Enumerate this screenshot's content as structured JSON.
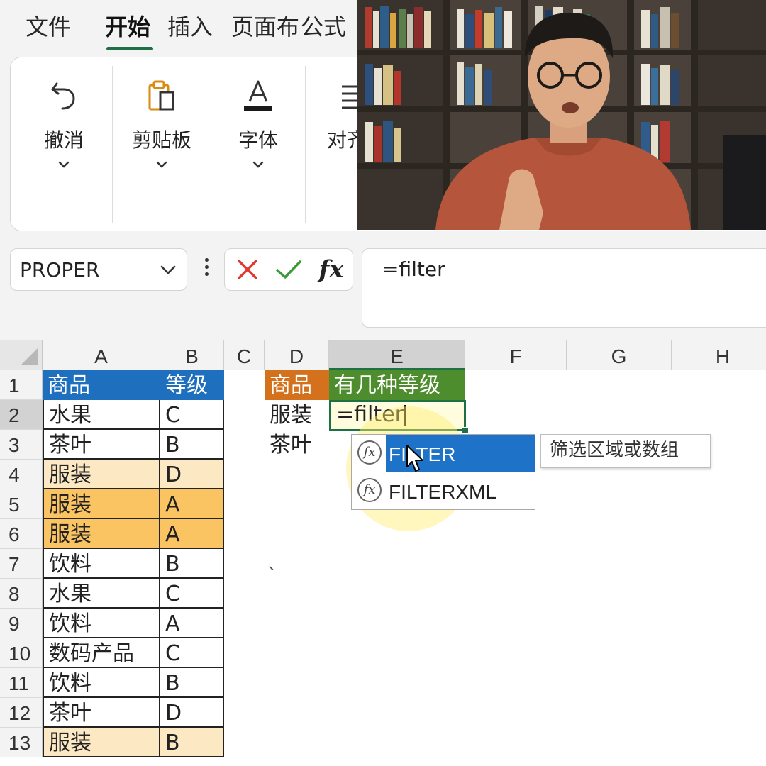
{
  "menu_tabs": [
    {
      "label": "文件"
    },
    {
      "label": "开始",
      "active": true
    },
    {
      "label": "插入"
    },
    {
      "label": "页面布"
    },
    {
      "label": "公式"
    }
  ],
  "ribbon": {
    "groups": [
      {
        "label": "撤消",
        "icon": "undo-icon"
      },
      {
        "label": "剪贴板",
        "icon": "clipboard-icon"
      },
      {
        "label": "字体",
        "icon": "font-color-icon"
      },
      {
        "label": "对齐",
        "icon": "align-icon"
      }
    ]
  },
  "formula_row": {
    "name_box": "PROPER",
    "formula": "=filter",
    "fx_label": "fx"
  },
  "grid": {
    "columns": [
      "A",
      "B",
      "C",
      "D",
      "E",
      "F",
      "G",
      "H"
    ],
    "selected_column": "E",
    "selected_row": "2",
    "row_numbers": [
      "1",
      "2",
      "3",
      "4",
      "5",
      "6",
      "7",
      "8",
      "9",
      "10",
      "11",
      "12",
      "13"
    ],
    "table_a": {
      "headers": [
        "商品",
        "等级"
      ],
      "rows": [
        {
          "item": "水果",
          "grade": "C"
        },
        {
          "item": "茶叶",
          "grade": "B"
        },
        {
          "item": "服装",
          "grade": "D"
        },
        {
          "item": "服装",
          "grade": "A"
        },
        {
          "item": "服装",
          "grade": "A"
        },
        {
          "item": "饮料",
          "grade": "B"
        },
        {
          "item": "水果",
          "grade": "C"
        },
        {
          "item": "饮料",
          "grade": "A"
        },
        {
          "item": "数码产品",
          "grade": "C"
        },
        {
          "item": "饮料",
          "grade": "B"
        },
        {
          "item": "茶叶",
          "grade": "D"
        },
        {
          "item": "服装",
          "grade": "B"
        }
      ]
    },
    "table_d": {
      "header_item": "商品",
      "header_count": "有几种等级",
      "items": [
        "服装",
        "茶叶"
      ]
    },
    "active_cell_text": "=filter",
    "stray_mark": "、"
  },
  "autocomplete": {
    "items": [
      {
        "label": "FILTER",
        "highlighted": true
      },
      {
        "label": "FILTERXML",
        "highlighted": false
      }
    ],
    "tooltip": "筛选区域或数组"
  },
  "colors": {
    "accent_green": "#1e7145",
    "header_blue": "#1f6fbf",
    "header_orange": "#d4711c",
    "header_green": "#4e8d2e",
    "fill_light": "#fde8c4",
    "fill_dark": "#fbc462",
    "autocomplete_highlight": "#1e73c8"
  }
}
